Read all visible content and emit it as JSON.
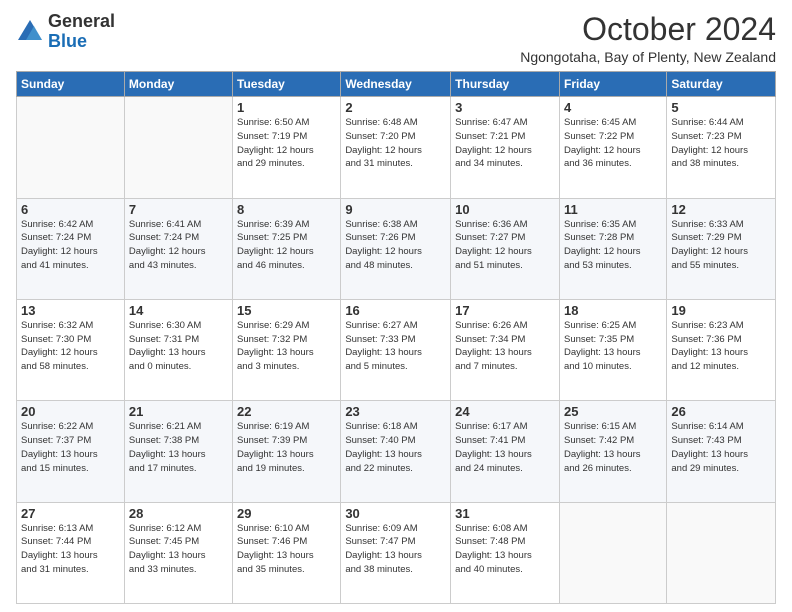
{
  "logo": {
    "general": "General",
    "blue": "Blue"
  },
  "header": {
    "month": "October 2024",
    "location": "Ngongotaha, Bay of Plenty, New Zealand"
  },
  "days_of_week": [
    "Sunday",
    "Monday",
    "Tuesday",
    "Wednesday",
    "Thursday",
    "Friday",
    "Saturday"
  ],
  "weeks": [
    [
      {
        "day": "",
        "info": ""
      },
      {
        "day": "",
        "info": ""
      },
      {
        "day": "1",
        "info": "Sunrise: 6:50 AM\nSunset: 7:19 PM\nDaylight: 12 hours\nand 29 minutes."
      },
      {
        "day": "2",
        "info": "Sunrise: 6:48 AM\nSunset: 7:20 PM\nDaylight: 12 hours\nand 31 minutes."
      },
      {
        "day": "3",
        "info": "Sunrise: 6:47 AM\nSunset: 7:21 PM\nDaylight: 12 hours\nand 34 minutes."
      },
      {
        "day": "4",
        "info": "Sunrise: 6:45 AM\nSunset: 7:22 PM\nDaylight: 12 hours\nand 36 minutes."
      },
      {
        "day": "5",
        "info": "Sunrise: 6:44 AM\nSunset: 7:23 PM\nDaylight: 12 hours\nand 38 minutes."
      }
    ],
    [
      {
        "day": "6",
        "info": "Sunrise: 6:42 AM\nSunset: 7:24 PM\nDaylight: 12 hours\nand 41 minutes."
      },
      {
        "day": "7",
        "info": "Sunrise: 6:41 AM\nSunset: 7:24 PM\nDaylight: 12 hours\nand 43 minutes."
      },
      {
        "day": "8",
        "info": "Sunrise: 6:39 AM\nSunset: 7:25 PM\nDaylight: 12 hours\nand 46 minutes."
      },
      {
        "day": "9",
        "info": "Sunrise: 6:38 AM\nSunset: 7:26 PM\nDaylight: 12 hours\nand 48 minutes."
      },
      {
        "day": "10",
        "info": "Sunrise: 6:36 AM\nSunset: 7:27 PM\nDaylight: 12 hours\nand 51 minutes."
      },
      {
        "day": "11",
        "info": "Sunrise: 6:35 AM\nSunset: 7:28 PM\nDaylight: 12 hours\nand 53 minutes."
      },
      {
        "day": "12",
        "info": "Sunrise: 6:33 AM\nSunset: 7:29 PM\nDaylight: 12 hours\nand 55 minutes."
      }
    ],
    [
      {
        "day": "13",
        "info": "Sunrise: 6:32 AM\nSunset: 7:30 PM\nDaylight: 12 hours\nand 58 minutes."
      },
      {
        "day": "14",
        "info": "Sunrise: 6:30 AM\nSunset: 7:31 PM\nDaylight: 13 hours\nand 0 minutes."
      },
      {
        "day": "15",
        "info": "Sunrise: 6:29 AM\nSunset: 7:32 PM\nDaylight: 13 hours\nand 3 minutes."
      },
      {
        "day": "16",
        "info": "Sunrise: 6:27 AM\nSunset: 7:33 PM\nDaylight: 13 hours\nand 5 minutes."
      },
      {
        "day": "17",
        "info": "Sunrise: 6:26 AM\nSunset: 7:34 PM\nDaylight: 13 hours\nand 7 minutes."
      },
      {
        "day": "18",
        "info": "Sunrise: 6:25 AM\nSunset: 7:35 PM\nDaylight: 13 hours\nand 10 minutes."
      },
      {
        "day": "19",
        "info": "Sunrise: 6:23 AM\nSunset: 7:36 PM\nDaylight: 13 hours\nand 12 minutes."
      }
    ],
    [
      {
        "day": "20",
        "info": "Sunrise: 6:22 AM\nSunset: 7:37 PM\nDaylight: 13 hours\nand 15 minutes."
      },
      {
        "day": "21",
        "info": "Sunrise: 6:21 AM\nSunset: 7:38 PM\nDaylight: 13 hours\nand 17 minutes."
      },
      {
        "day": "22",
        "info": "Sunrise: 6:19 AM\nSunset: 7:39 PM\nDaylight: 13 hours\nand 19 minutes."
      },
      {
        "day": "23",
        "info": "Sunrise: 6:18 AM\nSunset: 7:40 PM\nDaylight: 13 hours\nand 22 minutes."
      },
      {
        "day": "24",
        "info": "Sunrise: 6:17 AM\nSunset: 7:41 PM\nDaylight: 13 hours\nand 24 minutes."
      },
      {
        "day": "25",
        "info": "Sunrise: 6:15 AM\nSunset: 7:42 PM\nDaylight: 13 hours\nand 26 minutes."
      },
      {
        "day": "26",
        "info": "Sunrise: 6:14 AM\nSunset: 7:43 PM\nDaylight: 13 hours\nand 29 minutes."
      }
    ],
    [
      {
        "day": "27",
        "info": "Sunrise: 6:13 AM\nSunset: 7:44 PM\nDaylight: 13 hours\nand 31 minutes."
      },
      {
        "day": "28",
        "info": "Sunrise: 6:12 AM\nSunset: 7:45 PM\nDaylight: 13 hours\nand 33 minutes."
      },
      {
        "day": "29",
        "info": "Sunrise: 6:10 AM\nSunset: 7:46 PM\nDaylight: 13 hours\nand 35 minutes."
      },
      {
        "day": "30",
        "info": "Sunrise: 6:09 AM\nSunset: 7:47 PM\nDaylight: 13 hours\nand 38 minutes."
      },
      {
        "day": "31",
        "info": "Sunrise: 6:08 AM\nSunset: 7:48 PM\nDaylight: 13 hours\nand 40 minutes."
      },
      {
        "day": "",
        "info": ""
      },
      {
        "day": "",
        "info": ""
      }
    ]
  ]
}
